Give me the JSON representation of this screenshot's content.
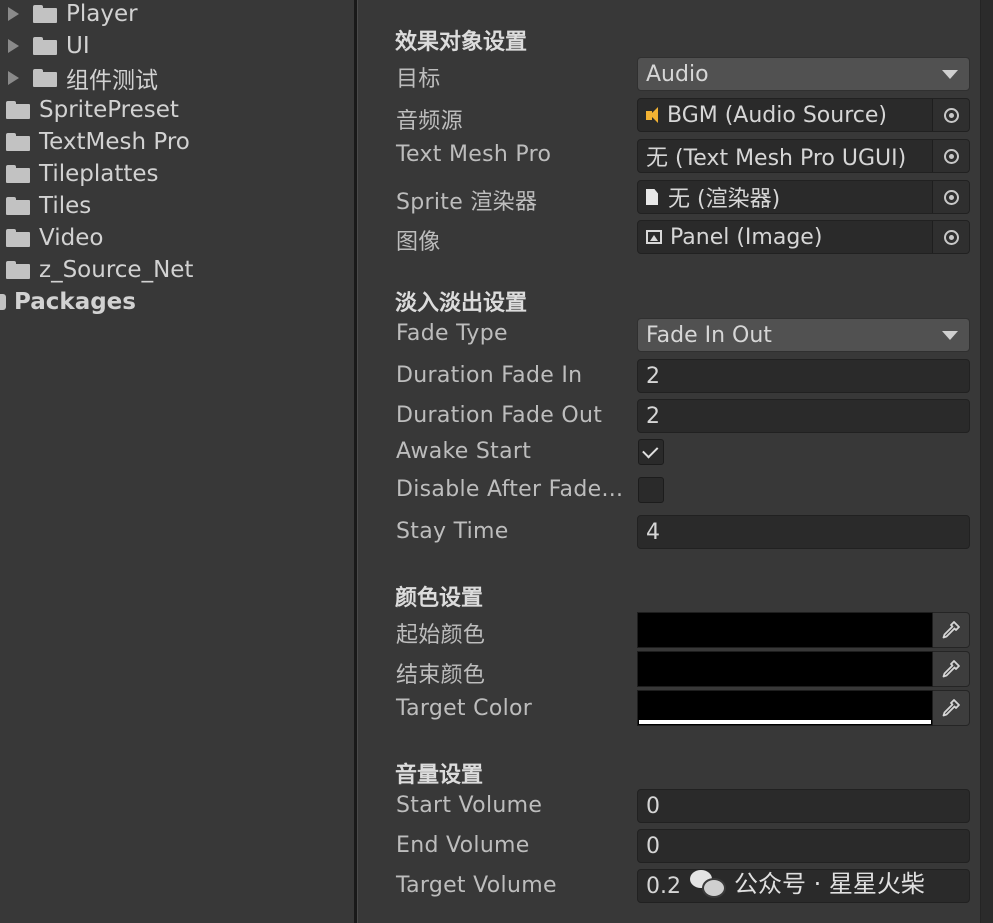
{
  "project_tree": {
    "items": [
      {
        "label": "Player",
        "expandable": true
      },
      {
        "label": "UI",
        "expandable": true
      },
      {
        "label": "组件测试",
        "expandable": true
      },
      {
        "label": "SpritePreset",
        "expandable": false
      },
      {
        "label": "TextMesh Pro",
        "expandable": false
      },
      {
        "label": "Tileplattes",
        "expandable": false
      },
      {
        "label": "Tiles",
        "expandable": false
      },
      {
        "label": "Video",
        "expandable": false
      },
      {
        "label": "z_Source_Net",
        "expandable": false
      }
    ],
    "packages_label": "Packages"
  },
  "inspector": {
    "effect_section": {
      "header": "效果对象设置",
      "target_label": "目标",
      "target_value": "Audio",
      "audio_source_label": "音频源",
      "audio_source_value": "BGM (Audio Source)",
      "text_mesh_label": "Text Mesh Pro",
      "text_mesh_value": "无 (Text Mesh Pro UGUI)",
      "sprite_renderer_label": "Sprite 渲染器",
      "sprite_renderer_value": "无 (渲染器)",
      "image_label": "图像",
      "image_value": "Panel (Image)"
    },
    "fade_section": {
      "header": "淡入淡出设置",
      "fade_type_label": "Fade Type",
      "fade_type_value": "Fade In Out",
      "duration_in_label": "Duration Fade In",
      "duration_in_value": "2",
      "duration_out_label": "Duration Fade Out",
      "duration_out_value": "2",
      "awake_start_label": "Awake Start",
      "awake_start_checked": true,
      "disable_after_label": "Disable After Fade...",
      "disable_after_checked": false,
      "stay_time_label": "Stay Time",
      "stay_time_value": "4"
    },
    "color_section": {
      "header": "颜色设置",
      "start_color_label": "起始颜色",
      "start_color": "#000000",
      "end_color_label": "结束颜色",
      "end_color": "#000000",
      "target_color_label": "Target Color",
      "target_color": "#000000",
      "target_color_alpha_bar": "#ffffff"
    },
    "volume_section": {
      "header": "音量设置",
      "start_volume_label": "Start Volume",
      "start_volume_value": "0",
      "end_volume_label": "End Volume",
      "end_volume_value": "0",
      "target_volume_label": "Target Volume",
      "target_volume_value": "0.2"
    }
  },
  "watermark": {
    "text": "公众号 · 星星火柴"
  },
  "colors": {
    "panel_bg": "#383838",
    "field_bg": "#2a2a2a",
    "dropdown_bg": "#515151",
    "audio_icon": "#f2b233"
  }
}
